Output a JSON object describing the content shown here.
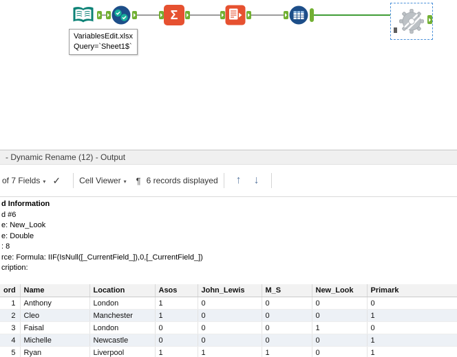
{
  "colors": {
    "anchor_green": "#72B033",
    "connection_green": "#3F9C35",
    "tool_orange": "#E65130",
    "tool_navy": "#1D4E89",
    "tool_teal": "#0C8276",
    "selection_blue": "#4A90D9",
    "alt_row": "#EDF1F6"
  },
  "icons": {
    "sigma": "Σ",
    "caret": "▾",
    "check": "✓",
    "pilcrow": "¶",
    "arrow_up": "↑",
    "arrow_down": "↓"
  },
  "canvas": {
    "tooltip_lines": [
      "VariablesEdit.xlsx",
      "Query=`Sheet1$`"
    ]
  },
  "results_pane": {
    "title": "- Dynamic Rename (12) - Output",
    "toolbar": {
      "fields_dropdown": "of 7 Fields",
      "cell_viewer_dropdown": "Cell Viewer",
      "records_displayed": "6 records displayed"
    }
  },
  "field_info": {
    "lines": [
      "d Information",
      "d #6",
      "e: New_Look",
      "e: Double",
      ": 8",
      "rce: Formula: IIF(IsNull([_CurrentField_]),0,[_CurrentField_])",
      "cription:"
    ]
  },
  "table": {
    "headers": [
      "ord",
      "Name",
      "Location",
      "Asos",
      "John_Lewis",
      "M_S",
      "New_Look",
      "Primark"
    ],
    "rows": [
      [
        "1",
        "Anthony",
        "London",
        "1",
        "0",
        "0",
        "0",
        "0"
      ],
      [
        "2",
        "Cleo",
        "Manchester",
        "1",
        "0",
        "0",
        "0",
        "1"
      ],
      [
        "3",
        "Faisal",
        "London",
        "0",
        "0",
        "0",
        "1",
        "0"
      ],
      [
        "4",
        "Michelle",
        "Newcastle",
        "0",
        "0",
        "0",
        "0",
        "1"
      ],
      [
        "5",
        "Ryan",
        "Liverpool",
        "1",
        "1",
        "1",
        "0",
        "1"
      ]
    ]
  }
}
